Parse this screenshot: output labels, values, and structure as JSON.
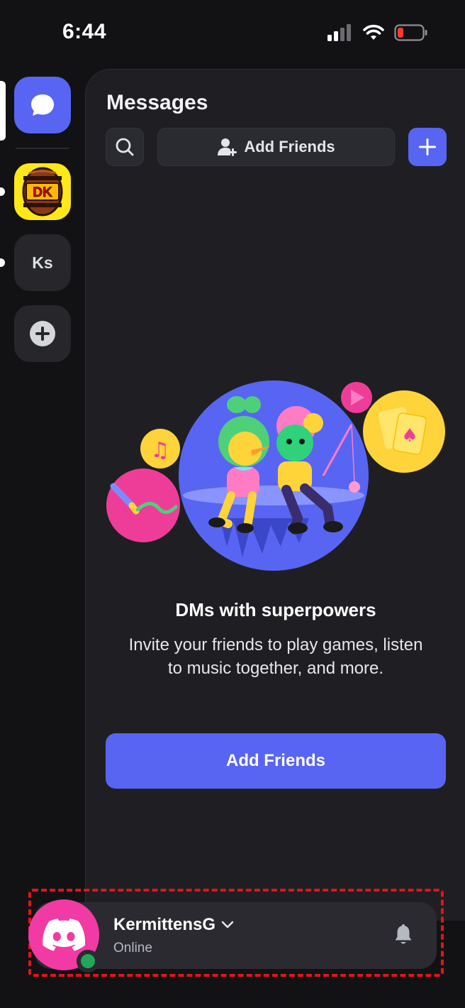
{
  "status_bar": {
    "time": "6:44",
    "icons": [
      "cellular-signal-icon",
      "wifi-icon",
      "battery-low-icon"
    ]
  },
  "server_rail": {
    "items": [
      {
        "name": "direct-messages",
        "icon": "chat-bubble-icon",
        "selected": true
      },
      {
        "name": "donkey-kong-server",
        "icon": "dk-barrel-icon",
        "unread": true
      },
      {
        "name": "ks-server",
        "label": "Ks",
        "unread": true
      },
      {
        "name": "add-server",
        "icon": "plus-circle-icon"
      }
    ]
  },
  "messages": {
    "title": "Messages",
    "add_friends_label": "Add Friends",
    "search_icon": "search-icon",
    "new_dm_icon": "plus-icon"
  },
  "empty_state": {
    "title": "DMs with superpowers",
    "body": "Invite your friends to play games, listen to music together, and more.",
    "button_label": "Add Friends"
  },
  "user_panel": {
    "username": "KermittensG",
    "status": "Online",
    "status_color": "#23a55a",
    "avatar_color": "#f23aa5"
  },
  "colors": {
    "accent": "#5865f2",
    "background": "#121214",
    "panel": "#1f1f23",
    "highlight_outline": "#e0141a"
  }
}
